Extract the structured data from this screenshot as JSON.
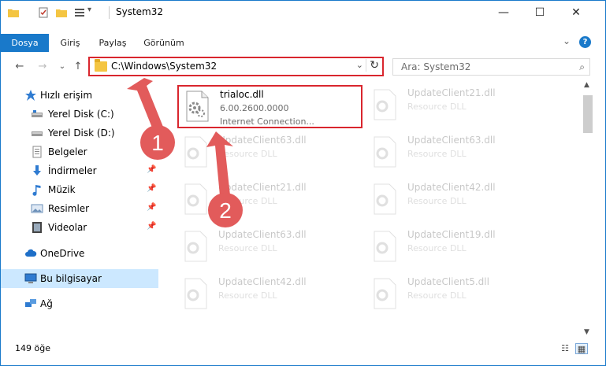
{
  "window": {
    "title": "System32",
    "minimize_label": "—",
    "maximize_label": "☐",
    "close_label": "✕"
  },
  "ribbon": {
    "tabs": [
      {
        "label": "Dosya"
      },
      {
        "label": "Giriş"
      },
      {
        "label": "Paylaş"
      },
      {
        "label": "Görünüm"
      }
    ],
    "expand_glyph": "⌄",
    "help_glyph": "?"
  },
  "nav": {
    "back_glyph": "←",
    "forward_glyph": "→",
    "recent_glyph": "⌄",
    "up_glyph": "↑",
    "address": "C:\\Windows\\System32",
    "address_chevron": "⌄",
    "refresh_glyph": "↻",
    "search_placeholder": "Ara: System32",
    "search_glyph": "⌕"
  },
  "sidebar": {
    "items": [
      {
        "label": "Hızlı erişim",
        "icon": "star-icon"
      },
      {
        "label": "Yerel Disk (C:)",
        "icon": "drive-icon"
      },
      {
        "label": "Yerel Disk (D:)",
        "icon": "drive-icon"
      },
      {
        "label": "Belgeler",
        "icon": "documents-icon"
      },
      {
        "label": "İndirmeler",
        "icon": "download-icon"
      },
      {
        "label": "Müzik",
        "icon": "music-icon"
      },
      {
        "label": "Resimler",
        "icon": "pictures-icon"
      },
      {
        "label": "Videolar",
        "icon": "video-icon"
      },
      {
        "label": "OneDrive",
        "icon": "cloud-icon"
      },
      {
        "label": "Bu bilgisayar",
        "icon": "computer-icon"
      },
      {
        "label": "Ağ",
        "icon": "network-icon"
      }
    ],
    "pin_glyph": "📌"
  },
  "files": {
    "highlighted": {
      "name": "trialoc.dll",
      "version": "6.00.2600.0000",
      "description": "Internet Connection..."
    },
    "background": [
      {
        "name": "UpdateClient21.dll",
        "type": "Resource DLL"
      },
      {
        "name": "UpdateClient63.dll",
        "type": "Resource DLL"
      },
      {
        "name": "UpdateClient63.dll",
        "type": "Resource DLL"
      },
      {
        "name": "UpdateClient21.dll",
        "type": "Resource DLL"
      },
      {
        "name": "UpdateClient42.dll",
        "type": "Resource DLL"
      },
      {
        "name": "UpdateClient63.dll",
        "type": "Resource DLL"
      },
      {
        "name": "UpdateClient19.dll",
        "type": "Resource DLL"
      },
      {
        "name": "UpdateClient42.dll",
        "type": "Resource DLL"
      },
      {
        "name": "UpdateClient5.dll",
        "type": "Resource DLL"
      }
    ]
  },
  "status": {
    "item_count": "149 öğe"
  },
  "annotations": [
    {
      "label": "1"
    },
    {
      "label": "2"
    }
  ],
  "colors": {
    "accent": "#1979ca",
    "highlight_border": "#d9262e",
    "arrow": "#e25b5b",
    "selected_nav": "#cce8ff"
  }
}
